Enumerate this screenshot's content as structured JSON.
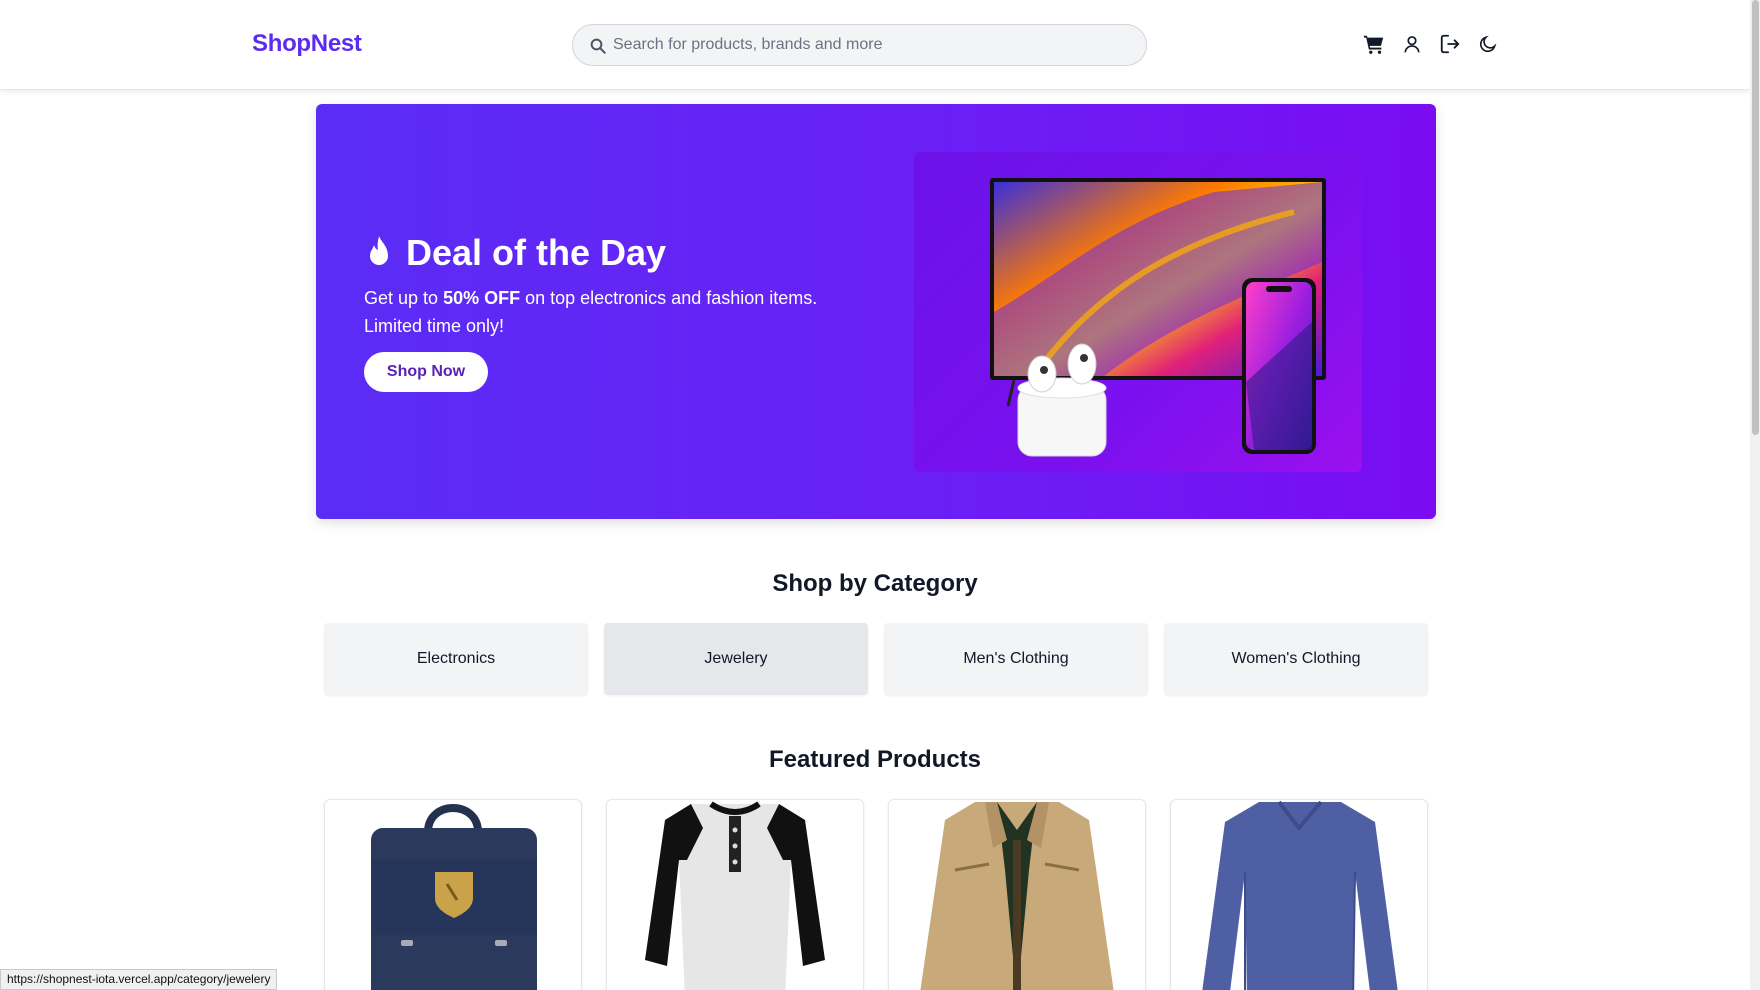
{
  "header": {
    "brand": "ShopNest",
    "search_placeholder": "Search for products, brands and more",
    "icons": [
      "cart-icon",
      "user-icon",
      "logout-icon",
      "moon-icon"
    ]
  },
  "hero": {
    "title": "Deal of the Day",
    "desc_prefix": "Get up to ",
    "desc_bold": "50% OFF",
    "desc_suffix": " on top electronics and fashion items. Limited time only!",
    "button_label": "Shop Now",
    "icon": "fire-icon"
  },
  "categories": {
    "title": "Shop by Category",
    "items": [
      "Electronics",
      "Jewelery",
      "Men's Clothing",
      "Women's Clothing"
    ]
  },
  "featured": {
    "title": "Featured Products",
    "items": [
      "backpack-image",
      "henley-shirt-image",
      "jacket-image",
      "long-sleeve-shirt-image"
    ]
  },
  "status_bar": {
    "url": "https://shopnest-iota.vercel.app/category/jewelery"
  },
  "colors": {
    "brand": "#5b2bf0",
    "hero_start": "#5a2df5",
    "hero_end": "#7a0cf2"
  }
}
